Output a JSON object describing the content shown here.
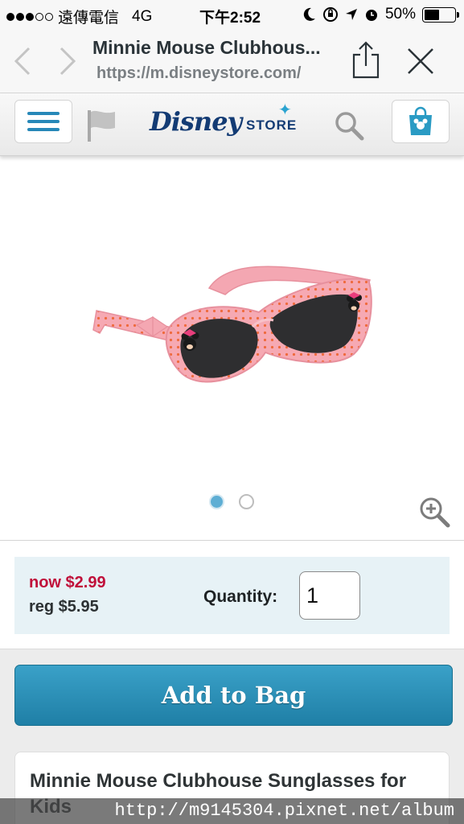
{
  "status_bar": {
    "carrier": "遠傳電信",
    "network": "4G",
    "time": "下午2:52",
    "battery_percent": "50%",
    "battery_level": 0.5,
    "signal_bars_filled": 3,
    "signal_bars_total": 5
  },
  "browser": {
    "page_title": "Minnie Mouse Clubhous...",
    "url": "https://m.disneystore.com/",
    "back_icon": "chevron-left-icon",
    "forward_icon": "chevron-right-icon",
    "share_icon": "share-icon",
    "close_icon": "close-icon"
  },
  "site_header": {
    "logo_disney": "Disney",
    "logo_store": "STORE",
    "menu_icon": "hamburger-menu-icon",
    "flag_icon": "flag-icon",
    "search_icon": "search-icon",
    "bag_icon": "shopping-bag-icon",
    "accent_color": "#2788b8",
    "logo_color": "#133b74"
  },
  "product": {
    "image_alt": "Minnie Mouse pink polka-dot sunglasses",
    "carousel": {
      "count": 2,
      "active_index": 0
    },
    "zoom_icon": "zoom-in-icon",
    "price_now": "now $2.99",
    "price_reg": "reg $5.95",
    "quantity_label": "Quantity:",
    "quantity_value": "1",
    "add_to_bag_label": "Add to Bag",
    "title": "Minnie Mouse Clubhouse Sunglasses for Kids",
    "sale_color": "#c0103a",
    "button_color": "#2a91ba"
  },
  "watermark": "http://m9145304.pixnet.net/album"
}
